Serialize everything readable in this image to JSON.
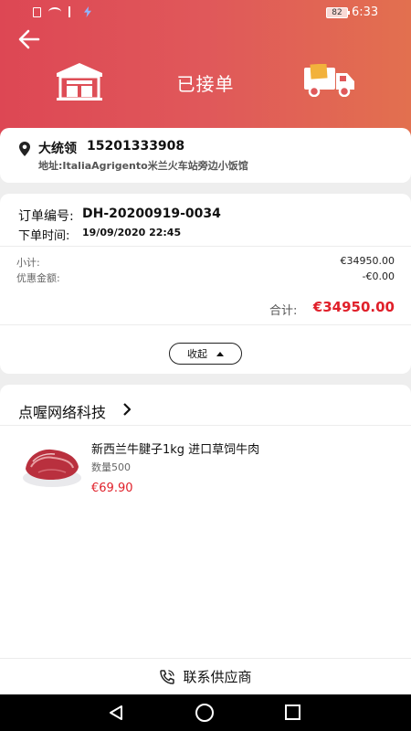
{
  "status_bar": {
    "battery": "82",
    "time": "6:33"
  },
  "header": {
    "status_title": "已接单"
  },
  "address": {
    "name": "大统领",
    "phone": "15201333908",
    "address_line": "地址:ItaliaAgrigento米兰火车站旁边小饭馆"
  },
  "order": {
    "number_label": "订单编号:",
    "number_value": "DH-20200919-0034",
    "time_label": "下单时间:",
    "time_value": "19/09/2020 22:45",
    "subtotal_label": "小计:",
    "subtotal_value": "€34950.00",
    "discount_label": "优惠金额:",
    "discount_value": "-€0.00",
    "total_label": "合计:",
    "total_value": "€34950.00",
    "collapse_label": "收起"
  },
  "shop": {
    "name": "点喔网络科技",
    "product": {
      "name": "新西兰牛腱子1kg 进口草饲牛肉",
      "quantity": "数量500",
      "price": "€69.90"
    }
  },
  "footer": {
    "contact_label": "联系供应商"
  },
  "colors": {
    "header_start": "#dd4754",
    "header_end": "#e2704f",
    "price_red": "#e0202a"
  }
}
